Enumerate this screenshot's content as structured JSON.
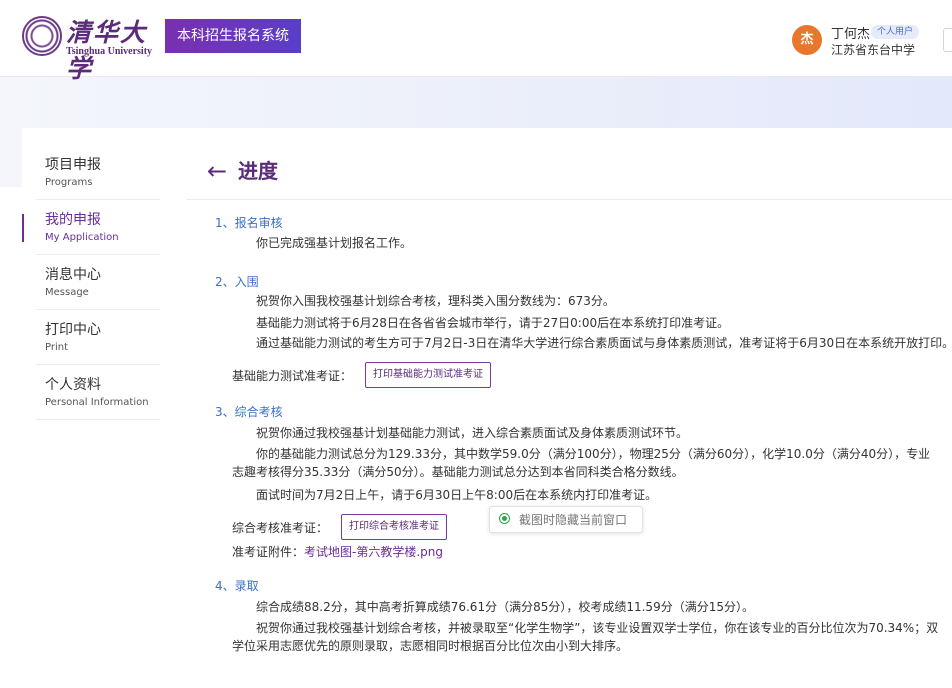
{
  "header": {
    "logo_cn": "清华大学",
    "logo_en": "Tsinghua University",
    "system_name": "本科招生报名系统",
    "user": {
      "avatar_char": "杰",
      "name": "丁何杰",
      "tag": "个人用户",
      "school": "江苏省东台中学"
    }
  },
  "sidebar": {
    "items": [
      {
        "cn": "项目申报",
        "en": "Programs",
        "active": false
      },
      {
        "cn": "我的申报",
        "en": "My Application",
        "active": true
      },
      {
        "cn": "消息中心",
        "en": "Message",
        "active": false
      },
      {
        "cn": "打印中心",
        "en": "Print",
        "active": false
      },
      {
        "cn": "个人资料",
        "en": "Personal Information",
        "active": false
      }
    ]
  },
  "page": {
    "back_arrow": "←",
    "title": "进度"
  },
  "sections": {
    "s1": {
      "heading": "1、报名审核",
      "p1": "你已完成强基计划报名工作。"
    },
    "s2": {
      "heading": "2、入围",
      "p1": "祝贺你入围我校强基计划综合考核，理科类入围分数线为：673分。",
      "p2": "基础能力测试将于6月28日在各省省会城市举行，请于27日0:00后在本系统打印准考证。",
      "p3": "通过基础能力测试的考生方可于7月2日-3日在清华大学进行综合素质面试与身体素质测试，准考证将于6月30日在本系统开放打印。",
      "label": "基础能力测试准考证：",
      "button": "打印基础能力测试准考证"
    },
    "s3": {
      "heading": "3、综合考核",
      "p1": "祝贺你通过我校强基计划基础能力测试，进入综合素质面试及身体素质测试环节。",
      "p2": "你的基础能力测试总分为129.33分，其中数学59.0分（满分100分），物理25分（满分60分），化学10.0分（满分40分），专业志趣考核得分35.33分（满分50分）。基础能力测试总分达到本省同科类合格分数线。",
      "p3": "面试时间为7月2日上午，请于6月30日上午8:00后在本系统内打印准考证。",
      "label": "综合考核准考证：",
      "button": "打印综合考核准考证",
      "attach_label": "准考证附件：",
      "attach_link": "考试地图-第六教学楼.png"
    },
    "s4": {
      "heading": "4、录取",
      "p1": "综合成绩88.2分，其中高考折算成绩76.61分（满分85分），校考成绩11.59分（满分15分）。",
      "p2": "祝贺你通过我校强基计划综合考核，并被录取至“化学生物学”，该专业设置双学士学位，你在该专业的百分比位次为70.34%；双学位采用志愿优先的原则录取，志愿相同时根据百分比位次由小到大排序。"
    }
  },
  "overlay": {
    "label": "截图时隐藏当前窗口"
  }
}
